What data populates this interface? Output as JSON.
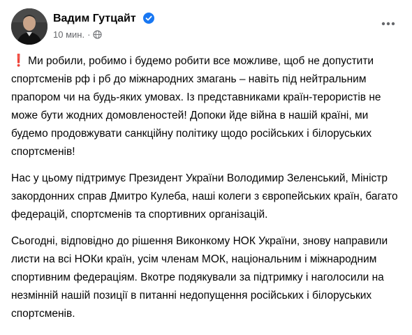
{
  "post": {
    "author": "Вадим Гутцайт",
    "time": "10 мин.",
    "dot": "·",
    "icons": {
      "verified": "verified-badge-icon",
      "audience": "globe-icon",
      "more": "more-options-icon",
      "emoji": "red-exclamation-icon"
    },
    "colors": {
      "verified": "#1877f2",
      "meta": "#65676b",
      "emoji": "#d11a1a"
    },
    "emoji": "❗",
    "paragraphs": [
      "Ми робили, робимо і будемо робити все можливе, щоб не допустити спортсменів рф і рб до міжнародних змагань – навіть під нейтральним прапором чи на будь-яких умовах. Із представниками країн-терористів не може бути жодних домовленостей! Допоки йде війна в нашій країні, ми будемо продовжувати санкційну політику щодо російських і білоруських спортсменів!",
      "Нас у цьому підтримує Президент України Володимир Зеленський, Міністр закордонних справ Дмитро Кулеба, наші колеги з європейських країн, багато федерацій, спортсменів та спортивних організацій.",
      "Сьогодні, відповідно до рішення Виконкому НОК України, знову направили листи на всі НОКи країн, усім членам МОК, національним і міжнародним спортивним федераціям. Вкотре подякували за підтримку і наголосили на незмінній нашій позиції в питанні недопущення російських і білоруських спортсменів."
    ]
  }
}
